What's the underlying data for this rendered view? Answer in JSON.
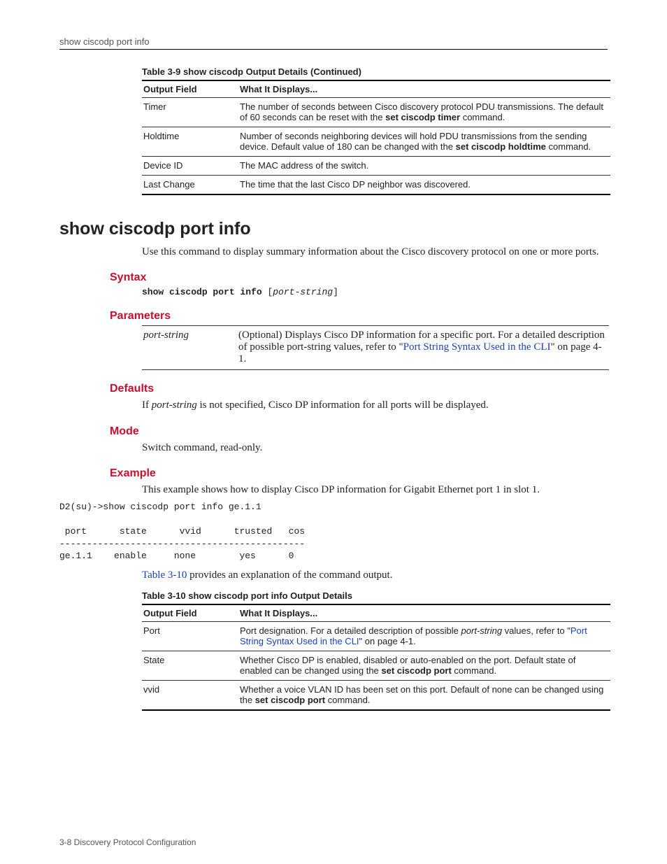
{
  "running_head": "show ciscodp port info",
  "table1": {
    "caption": "Table 3-9   show ciscodp Output Details (Continued)",
    "head_col1": "Output Field",
    "head_col2": "What It Displays...",
    "rows": [
      {
        "field": "Timer",
        "desc_pre": "The number of seconds between Cisco discovery protocol PDU transmissions. The default of 60 seconds can be reset with the ",
        "desc_cmd": "set ciscodp timer",
        "desc_post": " command."
      },
      {
        "field": "Holdtime",
        "desc_pre": "Number of seconds neighboring devices will hold PDU transmissions from the sending device. Default value of 180 can be changed with the ",
        "desc_cmd": "set ciscodp holdtime",
        "desc_post": " command."
      },
      {
        "field": "Device ID",
        "desc_pre": "The MAC address of the switch.",
        "desc_cmd": "",
        "desc_post": ""
      },
      {
        "field": "Last Change",
        "desc_pre": "The time that the last Cisco DP neighbor was discovered.",
        "desc_cmd": "",
        "desc_post": ""
      }
    ]
  },
  "cmd_title": "show ciscodp port info",
  "intro": "Use this command to display summary information about the Cisco discovery protocol on one or more ports.",
  "sec_syntax": "Syntax",
  "syntax_kw": "show ciscodp port info",
  "syntax_var": "port-string",
  "sec_parameters": "Parameters",
  "param_name": "port-string",
  "param_desc_pre": "(Optional) Displays Cisco DP information for a specific port. For a detailed description of possible port-string values, refer to \"",
  "param_link": "Port String Syntax Used in the CLI",
  "param_desc_post": "\" on page 4-1.",
  "sec_defaults": "Defaults",
  "defaults_pre": "If ",
  "defaults_italic": "port-string",
  "defaults_post": " is not specified, Cisco DP information for all ports will be displayed.",
  "sec_mode": "Mode",
  "mode_text": "Switch command, read-only.",
  "sec_example": "Example",
  "example_intro": "This example shows how to display Cisco DP information for Gigabit Ethernet port 1 in slot 1.",
  "example_code": "D2(su)->show ciscodp port info ge.1.1\n\n port      state      vvid      trusted   cos\n---------------------------------------------\nge.1.1    enable     none        yes      0",
  "example_ref_link": "Table 3-10",
  "example_ref_post": " provides an explanation of the command output.",
  "table2": {
    "caption": "Table 3-10   show ciscodp port info Output Details",
    "head_col1": "Output Field",
    "head_col2": "What It Displays...",
    "rows": [
      {
        "field": "Port",
        "pre": "Port designation. For a detailed description of possible ",
        "italic": "port-string",
        "mid": " values, refer to \"",
        "link": "Port String Syntax Used in the CLI",
        "post": "\" on page 4-1.",
        "cmd": "",
        "tail": ""
      },
      {
        "field": "State",
        "pre": "Whether Cisco DP is enabled, disabled or auto-enabled on the port. Default state of enabled can be changed using the ",
        "italic": "",
        "mid": "",
        "link": "",
        "post": "",
        "cmd": "set ciscodp port",
        "tail": " command."
      },
      {
        "field": "vvid",
        "pre": "Whether a voice VLAN ID has been set on this port. Default of none can be changed using the ",
        "italic": "",
        "mid": "",
        "link": "",
        "post": "",
        "cmd": "set ciscodp port",
        "tail": " command."
      }
    ]
  },
  "footer": "3-8   Discovery Protocol Configuration"
}
